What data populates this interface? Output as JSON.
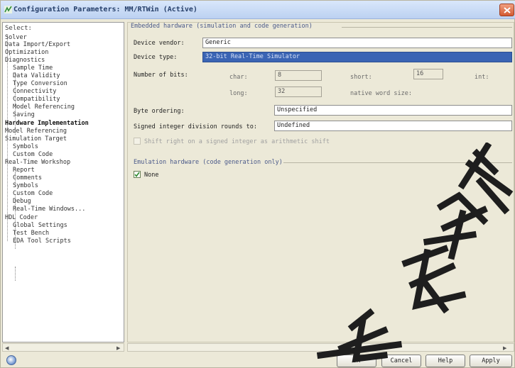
{
  "window": {
    "title": "Configuration Parameters: MM/RTWin (Active)"
  },
  "tree": {
    "header": "Select:",
    "items": [
      "Solver",
      "Data Import/Export",
      "Optimization",
      "Diagnostics",
      "Sample Time",
      "Data Validity",
      "Type Conversion",
      "Connectivity",
      "Compatibility",
      "Model Referencing",
      "Saving",
      "Hardware Implementation",
      "Model Referencing",
      "Simulation Target",
      "Symbols",
      "Custom Code",
      "Real-Time Workshop",
      "Report",
      "Comments",
      "Symbols",
      "Custom Code",
      "Debug",
      "Real-Time Windows...",
      "HDL Coder",
      "Global Settings",
      "Test Bench",
      "EDA Tool Scripts"
    ]
  },
  "embedded": {
    "group_title": "Embedded hardware (simulation and code generation)",
    "vendor_label": "Device vendor:",
    "vendor_value": "Generic",
    "type_label": "Device type:",
    "type_value": "32-bit Real-Time Simulator",
    "bits_label": "Number of bits:",
    "char_label": "char:",
    "char_value": "8",
    "short_label": "short:",
    "short_value": "16",
    "int_label": "int:",
    "long_label": "long:",
    "long_value": "32",
    "native_label": "native word size:",
    "byte_label": "Byte ordering:",
    "byte_value": "Unspecified",
    "signed_label": "Signed integer division rounds to:",
    "signed_value": "Undefined",
    "shift_label": "Shift right on a signed integer as arithmetic shift"
  },
  "emulation": {
    "group_title": "Emulation hardware (code generation only)",
    "none_label": "None"
  },
  "buttons": {
    "ok": "OK",
    "cancel": "Cancel",
    "help": "Help",
    "apply": "Apply"
  },
  "colors": {
    "selection": "#3a64b4",
    "group_title": "#4b5a8a",
    "watermark": "#1e1e1e"
  }
}
